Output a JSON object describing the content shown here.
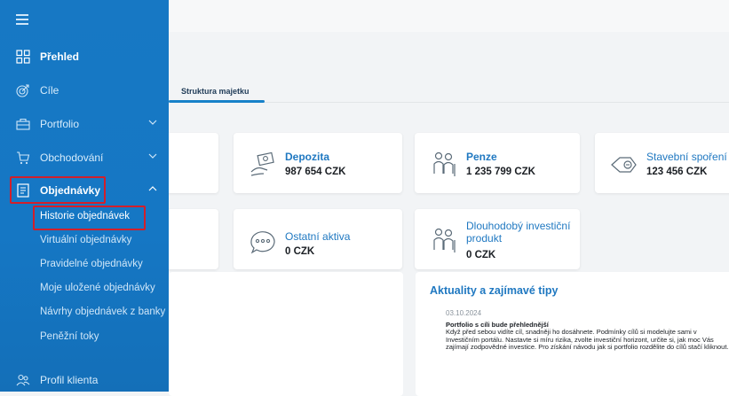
{
  "sidebar": {
    "items": [
      {
        "label": "Přehled",
        "icon": "grid-icon"
      },
      {
        "label": "Cíle",
        "icon": "target-icon"
      },
      {
        "label": "Portfolio",
        "icon": "briefcase-icon"
      },
      {
        "label": "Obchodování",
        "icon": "cart-icon"
      },
      {
        "label": "Objednávky",
        "icon": "document-icon"
      }
    ],
    "sub_items": [
      "Historie objednávek",
      "Virtuální objednávky",
      "Pravidelné objednávky",
      "Moje uložené objednávky",
      "Návrhy objednávek z banky",
      "Peněžní toky"
    ],
    "profile": {
      "label": "Profil klienta",
      "icon": "users-icon"
    }
  },
  "main": {
    "tab": "Struktura majetku",
    "cards": [
      {
        "title": "Depozita",
        "value": "987 654 CZK",
        "icon": "deposit-icon"
      },
      {
        "title": "Penze",
        "value": "1 235 799 CZK",
        "icon": "pension-icon"
      },
      {
        "title": "Stavební spoření",
        "value": "123 456 CZK",
        "icon": "savings-icon"
      },
      {
        "title": "Ostatní aktiva",
        "value": "0 CZK",
        "icon": "other-assets-icon"
      },
      {
        "title": "Dlouhodobý investiční produkt",
        "value": "0 CZK",
        "icon": "long-term-product-icon"
      }
    ],
    "news": {
      "heading": "Aktuality a zajímavé tipy",
      "date": "03.10.2024",
      "title": "Portfolio s cíli bude přehlednější",
      "body": "Když před sebou vidíte cíl, snadněji ho dosáhnete. Podmínky cílů si modelujte sami v Investičním portálu. Nastavte si míru rizika, zvolte investiční horizont, určite si, jak moc Vás zajímají zodpovědné investice. Pro získání návodu jak si portfolio rozdělite do cílů stačí kliknout."
    }
  },
  "colors": {
    "sidebar": "#1778c4",
    "accent": "#1f78c1",
    "highlight": "#d21f2a"
  }
}
